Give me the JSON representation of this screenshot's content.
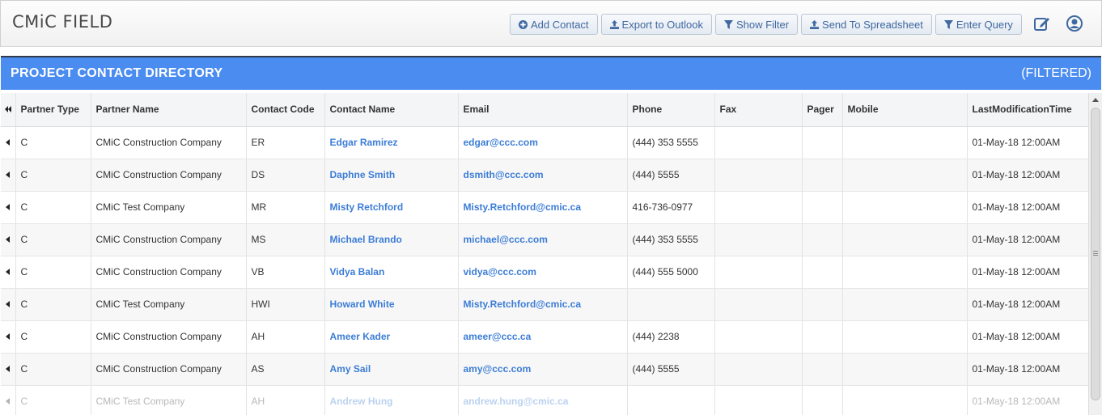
{
  "app": {
    "title": "CMiC FIELD"
  },
  "toolbar": {
    "add_contact": "Add Contact",
    "export_outlook": "Export to Outlook",
    "show_filter": "Show Filter",
    "send_spreadsheet": "Send To Spreadsheet",
    "enter_query": "Enter Query"
  },
  "panel": {
    "title": "PROJECT CONTACT DIRECTORY",
    "status": "(FILTERED)"
  },
  "colors": {
    "accent": "#4a8cf0",
    "link": "#3c7dd6",
    "button_text": "#3f68a0"
  },
  "grid": {
    "headers": [
      "Partner Type",
      "Partner Name",
      "Contact Code",
      "Contact Name",
      "Email",
      "Phone",
      "Fax",
      "Pager",
      "Mobile",
      "LastModificationTime"
    ],
    "rows": [
      [
        "C",
        "CMiC Construction Company",
        "ER",
        "Edgar Ramirez",
        "edgar@ccc.com",
        "(444) 353 5555",
        "",
        "",
        "",
        "01-May-18 12:00AM"
      ],
      [
        "C",
        "CMiC Construction Company",
        "DS",
        "Daphne Smith",
        "dsmith@ccc.com",
        "(444) 5555",
        "",
        "",
        "",
        "01-May-18 12:00AM"
      ],
      [
        "C",
        "CMiC Test Company",
        "MR",
        "Misty Retchford",
        "Misty.Retchford@cmic.ca",
        "416-736-0977",
        "",
        "",
        "",
        "01-May-18 12:00AM"
      ],
      [
        "C",
        "CMiC Construction Company",
        "MS",
        "Michael Brando",
        "michael@ccc.com",
        "(444) 353 5555",
        "",
        "",
        "",
        "01-May-18 12:00AM"
      ],
      [
        "C",
        "CMiC Construction Company",
        "VB",
        "Vidya Balan",
        "vidya@ccc.com",
        "(444) 555 5000",
        "",
        "",
        "",
        "01-May-18 12:00AM"
      ],
      [
        "C",
        "CMiC Test Company",
        "HWI",
        "Howard White",
        "Misty.Retchford@cmic.ca",
        "",
        "",
        "",
        "",
        "01-May-18 12:00AM"
      ],
      [
        "C",
        "CMiC Construction Company",
        "AH",
        "Ameer Kader",
        "ameer@ccc.ca",
        "(444) 2238",
        "",
        "",
        "",
        "01-May-18 12:00AM"
      ],
      [
        "C",
        "CMiC Construction Company",
        "AS",
        "Amy Sail",
        "amy@ccc.com",
        "(444) 5555",
        "",
        "",
        "",
        "01-May-18 12:00AM"
      ],
      [
        "C",
        "CMiC Test Company",
        "AH",
        "Andrew Hung",
        "andrew.hung@cmic.ca",
        "",
        "",
        "",
        "",
        "01-May-18 12:00AM"
      ]
    ]
  },
  "icons": {
    "add_contact": "plus-circle-icon",
    "export_outlook": "upload-icon",
    "show_filter": "filter-icon",
    "send_spreadsheet": "upload-icon",
    "enter_query": "filter-icon",
    "edit": "edit-icon",
    "user": "user-icon"
  }
}
